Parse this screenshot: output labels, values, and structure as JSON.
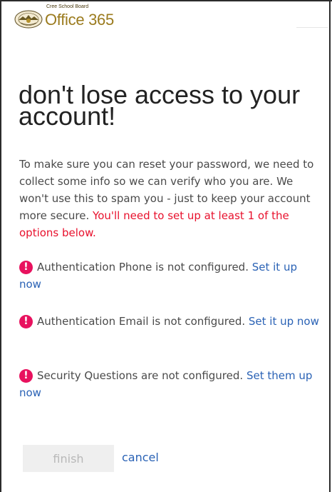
{
  "header": {
    "org_name": "Cree School Board",
    "product_name": "Office 365",
    "logo_icon": "school-board-seal-icon"
  },
  "main": {
    "title": "don't lose access to your account!",
    "intro_text": "To make sure you can reset your password, we need to collect some info so we can verify who you are. We won't use this to spam you - just to keep your account more secure. ",
    "intro_warning": "You'll need to set up at least 1 of the options below."
  },
  "options": [
    {
      "icon": "alert-icon",
      "status_text": "Authentication Phone is not configured. ",
      "link_label": "Set it up now"
    },
    {
      "icon": "alert-icon",
      "status_text": "Authentication Email is not configured. ",
      "link_label": "Set it up now"
    },
    {
      "icon": "alert-icon",
      "status_text": "Security Questions are not configured. ",
      "link_label": "Set them up now"
    }
  ],
  "actions": {
    "finish_label": "finish",
    "cancel_label": "cancel"
  },
  "colors": {
    "warning": "#e8112d",
    "alert_icon": "#e8115e",
    "link": "#2a62b5",
    "brand": "#9b7b1e"
  }
}
